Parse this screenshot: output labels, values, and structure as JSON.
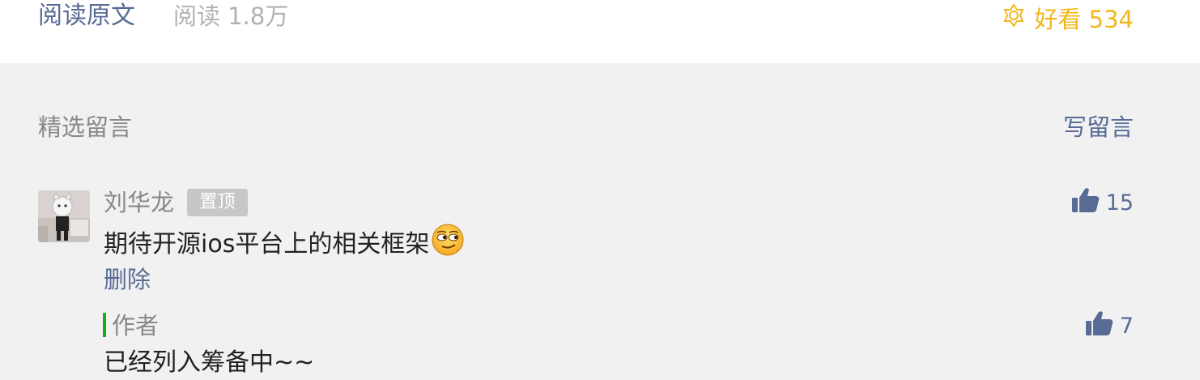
{
  "footer": {
    "read_original": "阅读原文",
    "read_count": "阅读 1.8万",
    "wow_label": "好看 534",
    "wow_color": "#f1b71c",
    "link_color": "#576b95"
  },
  "comments_section": {
    "title": "精选留言",
    "write_label": "写留言"
  },
  "comment": {
    "nickname": "刘华龙",
    "pin_badge": "置顶",
    "text": "期待开源ios平台上的相关框架",
    "emoji_icon": "smirk-emoji",
    "delete_label": "删除",
    "like_count": "15"
  },
  "reply": {
    "author": "作者",
    "text": "已经列入筹备中~~",
    "like_count": "7",
    "accent_color": "#1aad19"
  }
}
